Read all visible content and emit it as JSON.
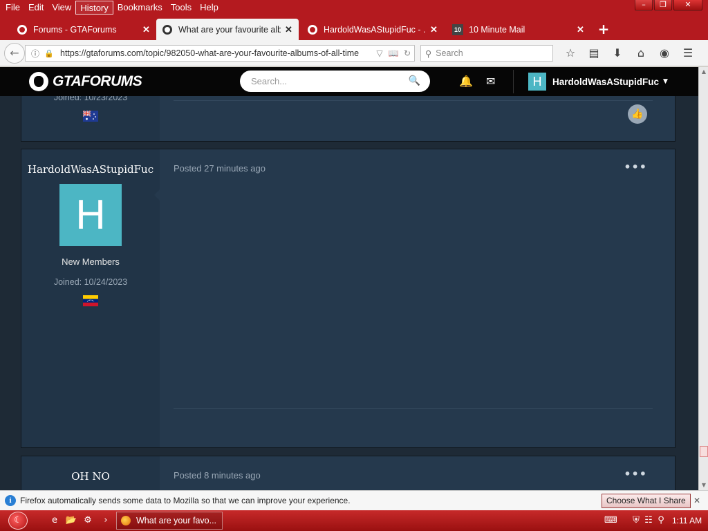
{
  "menubar": {
    "items": [
      "File",
      "Edit",
      "View",
      "History",
      "Bookmarks",
      "Tools",
      "Help"
    ]
  },
  "tabs": [
    {
      "title": "Forums - GTAForums",
      "active": false
    },
    {
      "title": "What are your favourite alb...",
      "active": true
    },
    {
      "title": "HardoldWasAStupidFuc - ...",
      "active": false
    },
    {
      "title": "10 Minute Mail",
      "active": false
    }
  ],
  "tab4_favicon": "10",
  "navbar": {
    "url": "https://gtaforums.com/topic/982050-what-are-your-favourite-albums-of-all-time",
    "search_placeholder": "Search"
  },
  "site": {
    "logo": "GTAFORUMS",
    "search_placeholder": "Search...",
    "username": "HardoldWasAStupidFuc",
    "user_initial": "H"
  },
  "posts": {
    "prev": {
      "joined": "Joined: 10/23/2023"
    },
    "current": {
      "author": "HardoldWasAStupidFuc",
      "avatar_letter": "H",
      "group": "New Members",
      "joined": "Joined: 10/24/2023",
      "posted": "Posted 27 minutes ago"
    },
    "next": {
      "author": "OH NO",
      "posted": "Posted 8 minutes ago"
    }
  },
  "notification": {
    "message": "Firefox automatically sends some data to Mozilla so that we can improve your experience.",
    "button": "Choose What I Share"
  },
  "taskbar": {
    "task_title": "What are your favo...",
    "clock": "1:11 AM"
  },
  "colors": {
    "chrome_red": "#b41a1f",
    "page_bg": "#1e2a36",
    "post_bg": "#25394d",
    "author_bg": "#213447",
    "avatar": "#4cb6c4"
  }
}
